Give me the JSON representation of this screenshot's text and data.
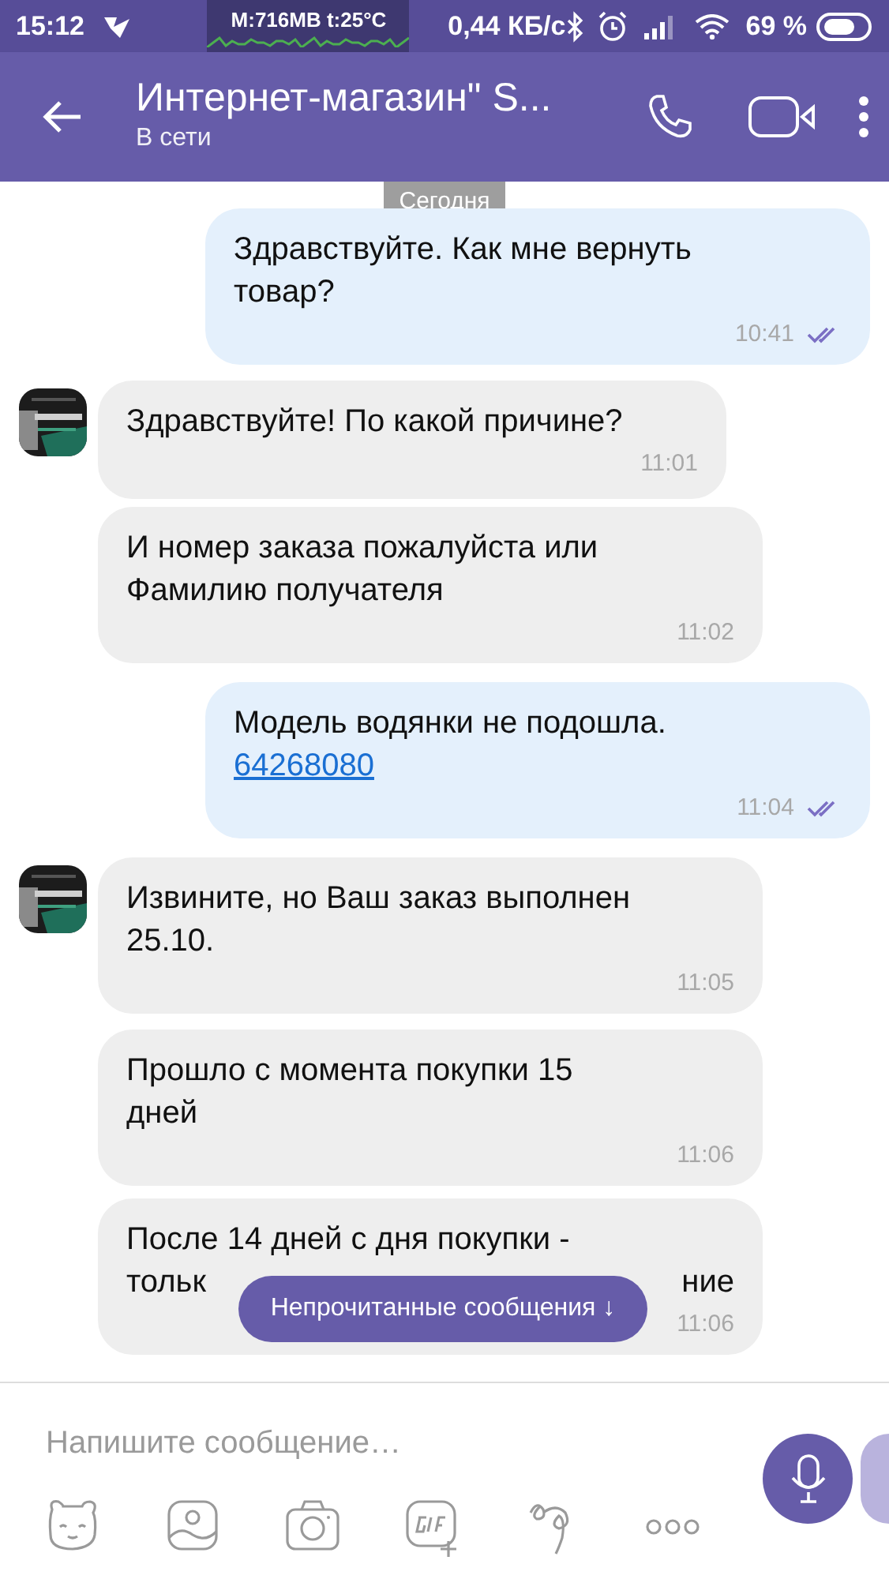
{
  "status_bar": {
    "time": "15:12",
    "memory": "M:716MB t:25°C",
    "speed": "0,44 КБ/с",
    "battery": "69 %"
  },
  "header": {
    "title": "Интернет-магазин\" S...",
    "subtitle": "В сети"
  },
  "date_label": "Сегодня",
  "messages": [
    {
      "kind": "outgoing",
      "text": "Здравствуйте. Как мне вернуть\nтовар?",
      "time": "10:41",
      "read": true
    },
    {
      "kind": "incoming",
      "avatar": true,
      "text": "Здравствуйте! По какой причине?",
      "time": "11:01"
    },
    {
      "kind": "incoming",
      "avatar": false,
      "text": "И номер заказа пожалуйста или\nФамилию получателя",
      "time": "11:02"
    },
    {
      "kind": "outgoing",
      "text": "Модель водянки не подошла.",
      "link": "64268080",
      "time": "11:04",
      "read": true
    },
    {
      "kind": "incoming",
      "avatar": true,
      "text": "Извините, но Ваш заказ выполнен\n25.10.",
      "time": "11:05"
    },
    {
      "kind": "incoming",
      "avatar": false,
      "text": "Прошло с момента покупки 15\nдней",
      "time": "11:06"
    },
    {
      "kind": "incoming",
      "avatar": false,
      "text": "После 14 дней с дня покупки -",
      "hidden_start": "тольк",
      "hidden_end": "ние",
      "time": "11:06"
    }
  ],
  "unread_pill": {
    "label": "Непрочитанные сообщения",
    "arrow": "↓"
  },
  "composer": {
    "placeholder": "Напишите сообщение…"
  }
}
